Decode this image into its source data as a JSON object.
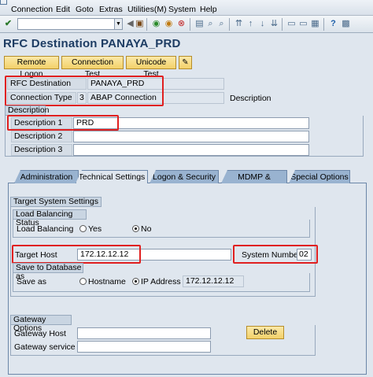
{
  "menu": [
    "Connection",
    "Edit",
    "Goto",
    "Extras",
    "Utilities(M)",
    "System",
    "Help"
  ],
  "page_title": "RFC Destination PANAYA_PRD",
  "app_toolbar": {
    "remote_logon": "Remote Logon",
    "connection_test": "Connection Test",
    "unicode_test": "Unicode Test"
  },
  "header": {
    "rfc_destination_label": "RFC Destination",
    "rfc_destination_value": "PANAYA_PRD",
    "connection_type_label": "Connection Type",
    "connection_type_code": "3",
    "connection_type_text": "ABAP Connection",
    "description_label": "Description"
  },
  "description_group": {
    "title": "Description",
    "desc1_label": "Description 1",
    "desc1_value": "PRD",
    "desc2_label": "Description 2",
    "desc2_value": "",
    "desc3_label": "Description 3",
    "desc3_value": ""
  },
  "tabs": [
    "Administration",
    "Technical Settings",
    "Logon & Security",
    "MDMP & Unicode",
    "Special Options"
  ],
  "active_tab": "Technical Settings",
  "target_system": {
    "title": "Target System Settings",
    "load_balancing_status_title": "Load Balancing Status",
    "load_balancing_label": "Load Balancing",
    "yes_label": "Yes",
    "no_label": "No",
    "load_balancing_selected": "No",
    "target_host_label": "Target Host",
    "target_host_value": "172.12.12.12",
    "system_number_label": "System Number",
    "system_number_value": "02",
    "save_to_db_title": "Save to Database as",
    "save_as_label": "Save as",
    "hostname_label": "Hostname",
    "ip_address_label": "IP Address",
    "save_as_selected": "IP Address",
    "ip_value": "172.12.12.12"
  },
  "gateway": {
    "title": "Gateway Options",
    "host_label": "Gateway Host",
    "host_value": "",
    "service_label": "Gateway service",
    "service_value": "",
    "delete_label": "Delete"
  }
}
